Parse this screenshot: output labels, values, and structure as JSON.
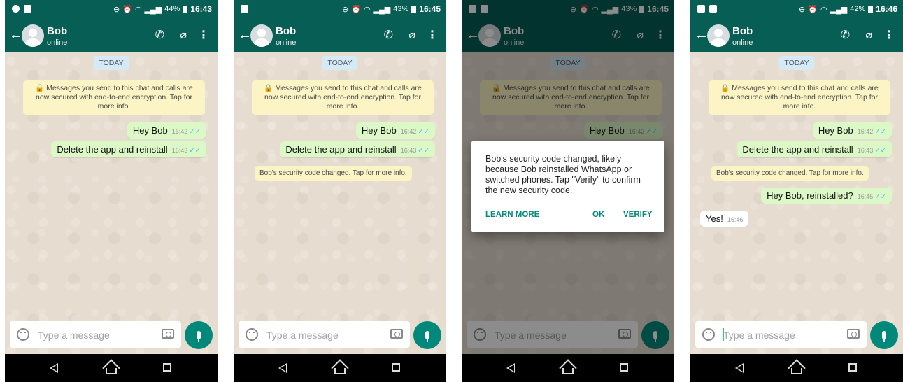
{
  "status_times": [
    "16:43",
    "16:45",
    "16:45",
    "16:46"
  ],
  "battery": [
    "44%",
    "43%",
    "43%",
    "42%"
  ],
  "contact": {
    "name": "Bob",
    "status": "online"
  },
  "date_chip": "TODAY",
  "encryption_note": "🔒 Messages you send to this chat and calls are now secured with end-to-end encryption. Tap for more info.",
  "messages": {
    "hey_bob": {
      "text": "Hey Bob",
      "time": "16:42"
    },
    "delete_app": {
      "text": "Delete the app and reinstall",
      "time": "16:43"
    },
    "reinstalled": {
      "text": "Hey Bob, reinstalled?",
      "time": "16:45"
    },
    "yes": {
      "text": "Yes!",
      "time": "16:46"
    }
  },
  "security_chip": "Bob's security code changed. Tap for more info.",
  "input": {
    "placeholder": "Type a message"
  },
  "dialog": {
    "message": "Bob's security code changed, likely because Bob reinstalled WhatsApp or switched phones. Tap \"Verify\" to confirm the new security code.",
    "learn_more": "LEARN MORE",
    "ok": "OK",
    "verify": "VERIFY"
  },
  "ticks": "✓✓",
  "colors": {
    "header": "#075e54",
    "outgoing": "#dcf8c6",
    "accent": "#00897b",
    "note": "#fcf4c4"
  }
}
